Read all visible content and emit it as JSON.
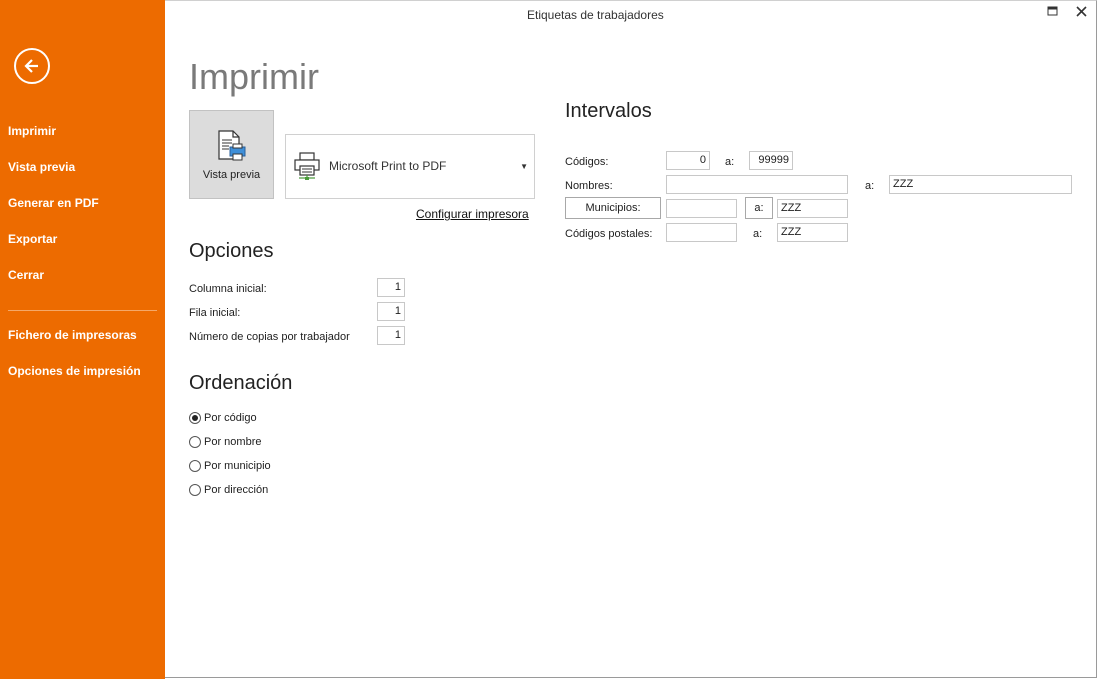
{
  "window": {
    "title": "Etiquetas de trabajadores"
  },
  "sidebar": {
    "items": [
      {
        "label": "Imprimir"
      },
      {
        "label": "Vista previa"
      },
      {
        "label": "Generar en PDF"
      },
      {
        "label": "Exportar"
      },
      {
        "label": "Cerrar"
      },
      {
        "label": "Fichero de impresoras"
      },
      {
        "label": "Opciones de impresión"
      }
    ]
  },
  "main": {
    "title": "Imprimir",
    "preview_button": "Vista previa",
    "printer": "Microsoft Print to PDF",
    "configure_link": "Configurar impresora"
  },
  "options": {
    "title": "Opciones",
    "fields": [
      {
        "label": "Columna inicial:",
        "value": "1"
      },
      {
        "label": "Fila inicial:",
        "value": "1"
      },
      {
        "label": "Número de copias por trabajador",
        "value": "1"
      }
    ]
  },
  "ordering": {
    "title": "Ordenación",
    "selected_index": 0,
    "options": [
      {
        "label": "Por código"
      },
      {
        "label": "Por nombre"
      },
      {
        "label": "Por municipio"
      },
      {
        "label": "Por dirección"
      }
    ]
  },
  "intervals": {
    "title": "Intervalos",
    "to_label": "a:",
    "codigos": {
      "label": "Códigos:",
      "from": "0",
      "to": "99999"
    },
    "nombres": {
      "label": "Nombres:",
      "from": "",
      "to": "ZZZ"
    },
    "municipios": {
      "label": "Municipios:",
      "from": "",
      "to": "ZZZ"
    },
    "codigos_postales": {
      "label": "Códigos postales:",
      "from": "",
      "to": "ZZZ"
    }
  }
}
